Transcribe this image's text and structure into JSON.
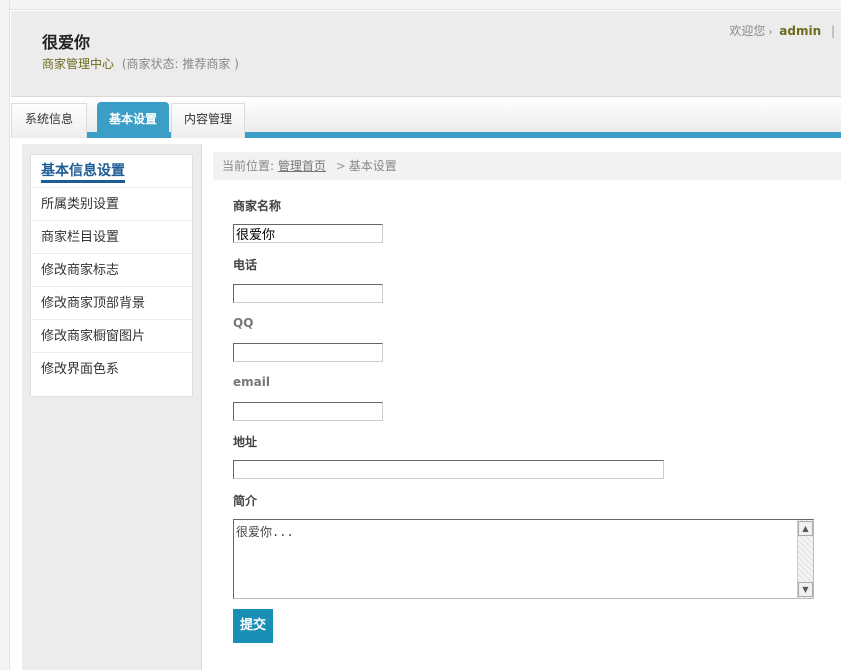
{
  "header": {
    "site_title": "很爱你",
    "center_link": "商家管理中心",
    "status_text": "(商家状态: 推荐商家  )",
    "welcome_text": "欢迎您",
    "welcome_arrow": "›",
    "username": "admin",
    "separator": "|"
  },
  "nav": {
    "tabs": [
      {
        "label": "系统信息"
      },
      {
        "label": "基本设置",
        "active": true
      },
      {
        "label": "内容管理"
      }
    ]
  },
  "sidebar": {
    "items": [
      {
        "label": "基本信息设置",
        "active": true
      },
      {
        "label": "所属类别设置"
      },
      {
        "label": "商家栏目设置"
      },
      {
        "label": "修改商家标志"
      },
      {
        "label": "修改商家顶部背景"
      },
      {
        "label": "修改商家橱窗图片"
      },
      {
        "label": "修改界面色系"
      }
    ]
  },
  "breadcrumb": {
    "prefix": "当前位置:",
    "home_link": "管理首页",
    "sep": ">",
    "current": "基本设置"
  },
  "form": {
    "name_label": "商家名称",
    "name_value": "很爱你",
    "phone_label": "电话",
    "phone_value": "",
    "qq_label": "QQ",
    "qq_value": "",
    "email_label": "email",
    "email_value": "",
    "address_label": "地址",
    "address_value": "",
    "intro_label": "简介",
    "intro_value": "很爱你...",
    "submit_label": "提交"
  },
  "colors": {
    "accent": "#3a9ec7",
    "submit": "#1a8fb5",
    "sidebar_active": "#1e5c96",
    "header_link": "#6b6b1f"
  },
  "icons": {
    "scroll_up": "▲",
    "scroll_down": "▼"
  }
}
